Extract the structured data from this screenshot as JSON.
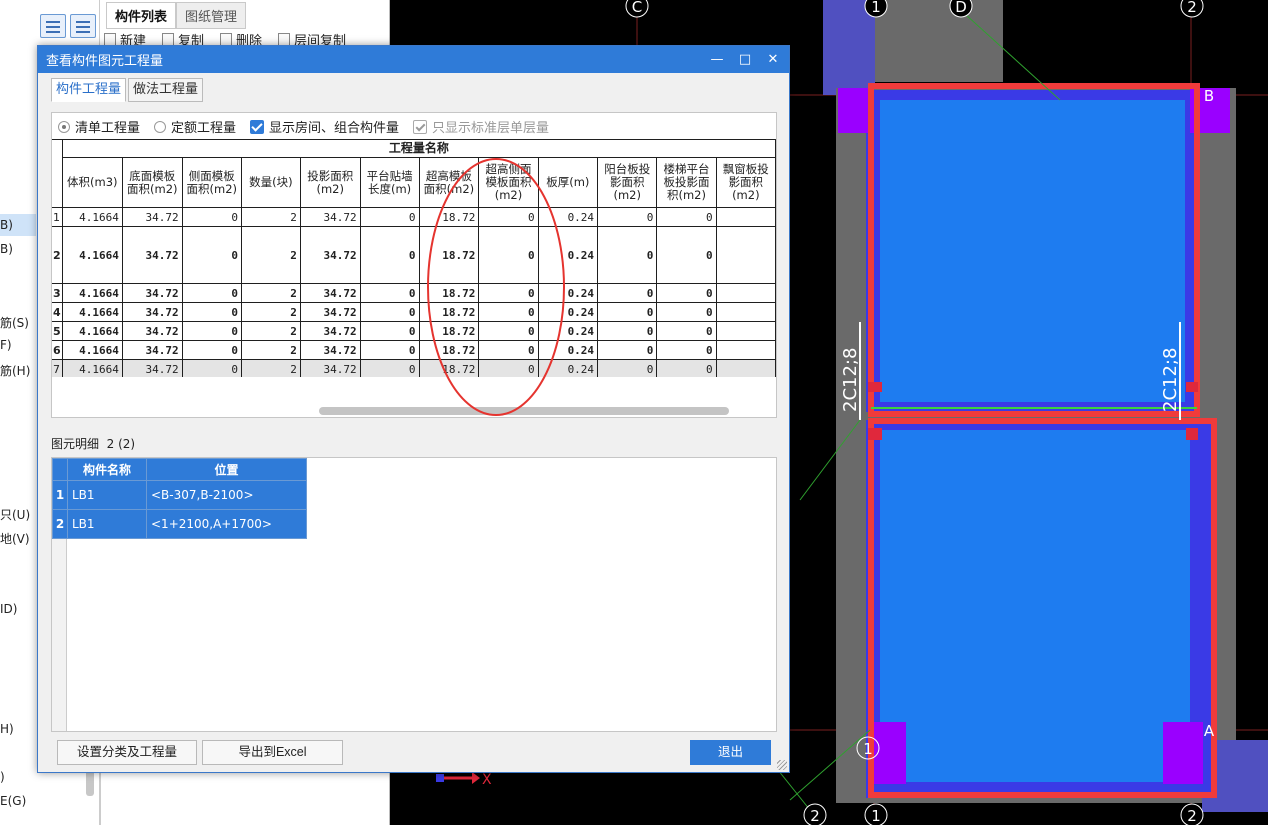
{
  "left_panel": {
    "letters": [
      "B)",
      "B)",
      "筋(S)",
      "F)",
      "筋(H)",
      "只(U)",
      "地(V)",
      "ID)",
      "H)",
      ")",
      "E(G)"
    ]
  },
  "component_panel": {
    "tabs": [
      "构件列表",
      "图纸管理"
    ],
    "toolbar": [
      "新建",
      "复制",
      "删除",
      "层间复制"
    ]
  },
  "cad": {
    "axis_labels": {
      "C": "C",
      "D": "D",
      "one_top": "1",
      "two_top": "2",
      "B": "B",
      "A": "A",
      "one_bottom": "1",
      "two_bottom": "2",
      "one_left": "1",
      "two_bl": "2"
    },
    "rebar_text": "2C12;8",
    "coord_x": "X"
  },
  "dialog": {
    "title": "查看构件图元工程量",
    "tabs": [
      "构件工程量",
      "做法工程量"
    ],
    "options": {
      "list_qty": "清单工程量",
      "quota_qty": "定额工程量",
      "show_room": "显示房间、组合构件量",
      "std_floor": "只显示标准层单层量"
    },
    "table": {
      "group_header": "工程量名称",
      "columns": [
        "体积(m3)",
        "底面模板面积(m2)",
        "侧面模板面积(m2)",
        "数量(块)",
        "投影面积(m2)",
        "平台贴墙长度(m)",
        "超高模板面积(m2)",
        "超高侧面模板面积(m2)",
        "板厚(m)",
        "阳台板投影面积(m2)",
        "楼梯平台板投影面积(m2)",
        "飘窗板投影面积(m2)"
      ],
      "rows": [
        {
          "n": "1",
          "v": [
            "4.1664",
            "34.72",
            "0",
            "2",
            "34.72",
            "0",
            "18.72",
            "0",
            "0.24",
            "0",
            "0",
            ""
          ]
        },
        {
          "n": "2",
          "v": [
            "4.1664",
            "34.72",
            "0",
            "2",
            "34.72",
            "0",
            "18.72",
            "0",
            "0.24",
            "0",
            "0",
            ""
          ]
        },
        {
          "n": "3",
          "v": [
            "4.1664",
            "34.72",
            "0",
            "2",
            "34.72",
            "0",
            "18.72",
            "0",
            "0.24",
            "0",
            "0",
            ""
          ]
        },
        {
          "n": "4",
          "v": [
            "4.1664",
            "34.72",
            "0",
            "2",
            "34.72",
            "0",
            "18.72",
            "0",
            "0.24",
            "0",
            "0",
            ""
          ]
        },
        {
          "n": "5",
          "v": [
            "4.1664",
            "34.72",
            "0",
            "2",
            "34.72",
            "0",
            "18.72",
            "0",
            "0.24",
            "0",
            "0",
            ""
          ]
        },
        {
          "n": "6",
          "v": [
            "4.1664",
            "34.72",
            "0",
            "2",
            "34.72",
            "0",
            "18.72",
            "0",
            "0.24",
            "0",
            "0",
            ""
          ]
        },
        {
          "n": "7",
          "v": [
            "4.1664",
            "34.72",
            "0",
            "2",
            "34.72",
            "0",
            "18.72",
            "0",
            "0.24",
            "0",
            "0",
            ""
          ]
        }
      ]
    },
    "detail": {
      "label": "图元明细",
      "count": "2 (2)",
      "columns": [
        "构件名称",
        "位置"
      ],
      "rows": [
        {
          "n": "1",
          "name": "LB1",
          "pos": "<B-307,B-2100>"
        },
        {
          "n": "2",
          "name": "LB1",
          "pos": "<1+2100,A+1700>"
        }
      ]
    },
    "buttons": {
      "classify": "设置分类及工程量",
      "export": "导出到Excel",
      "exit": "退出"
    }
  }
}
